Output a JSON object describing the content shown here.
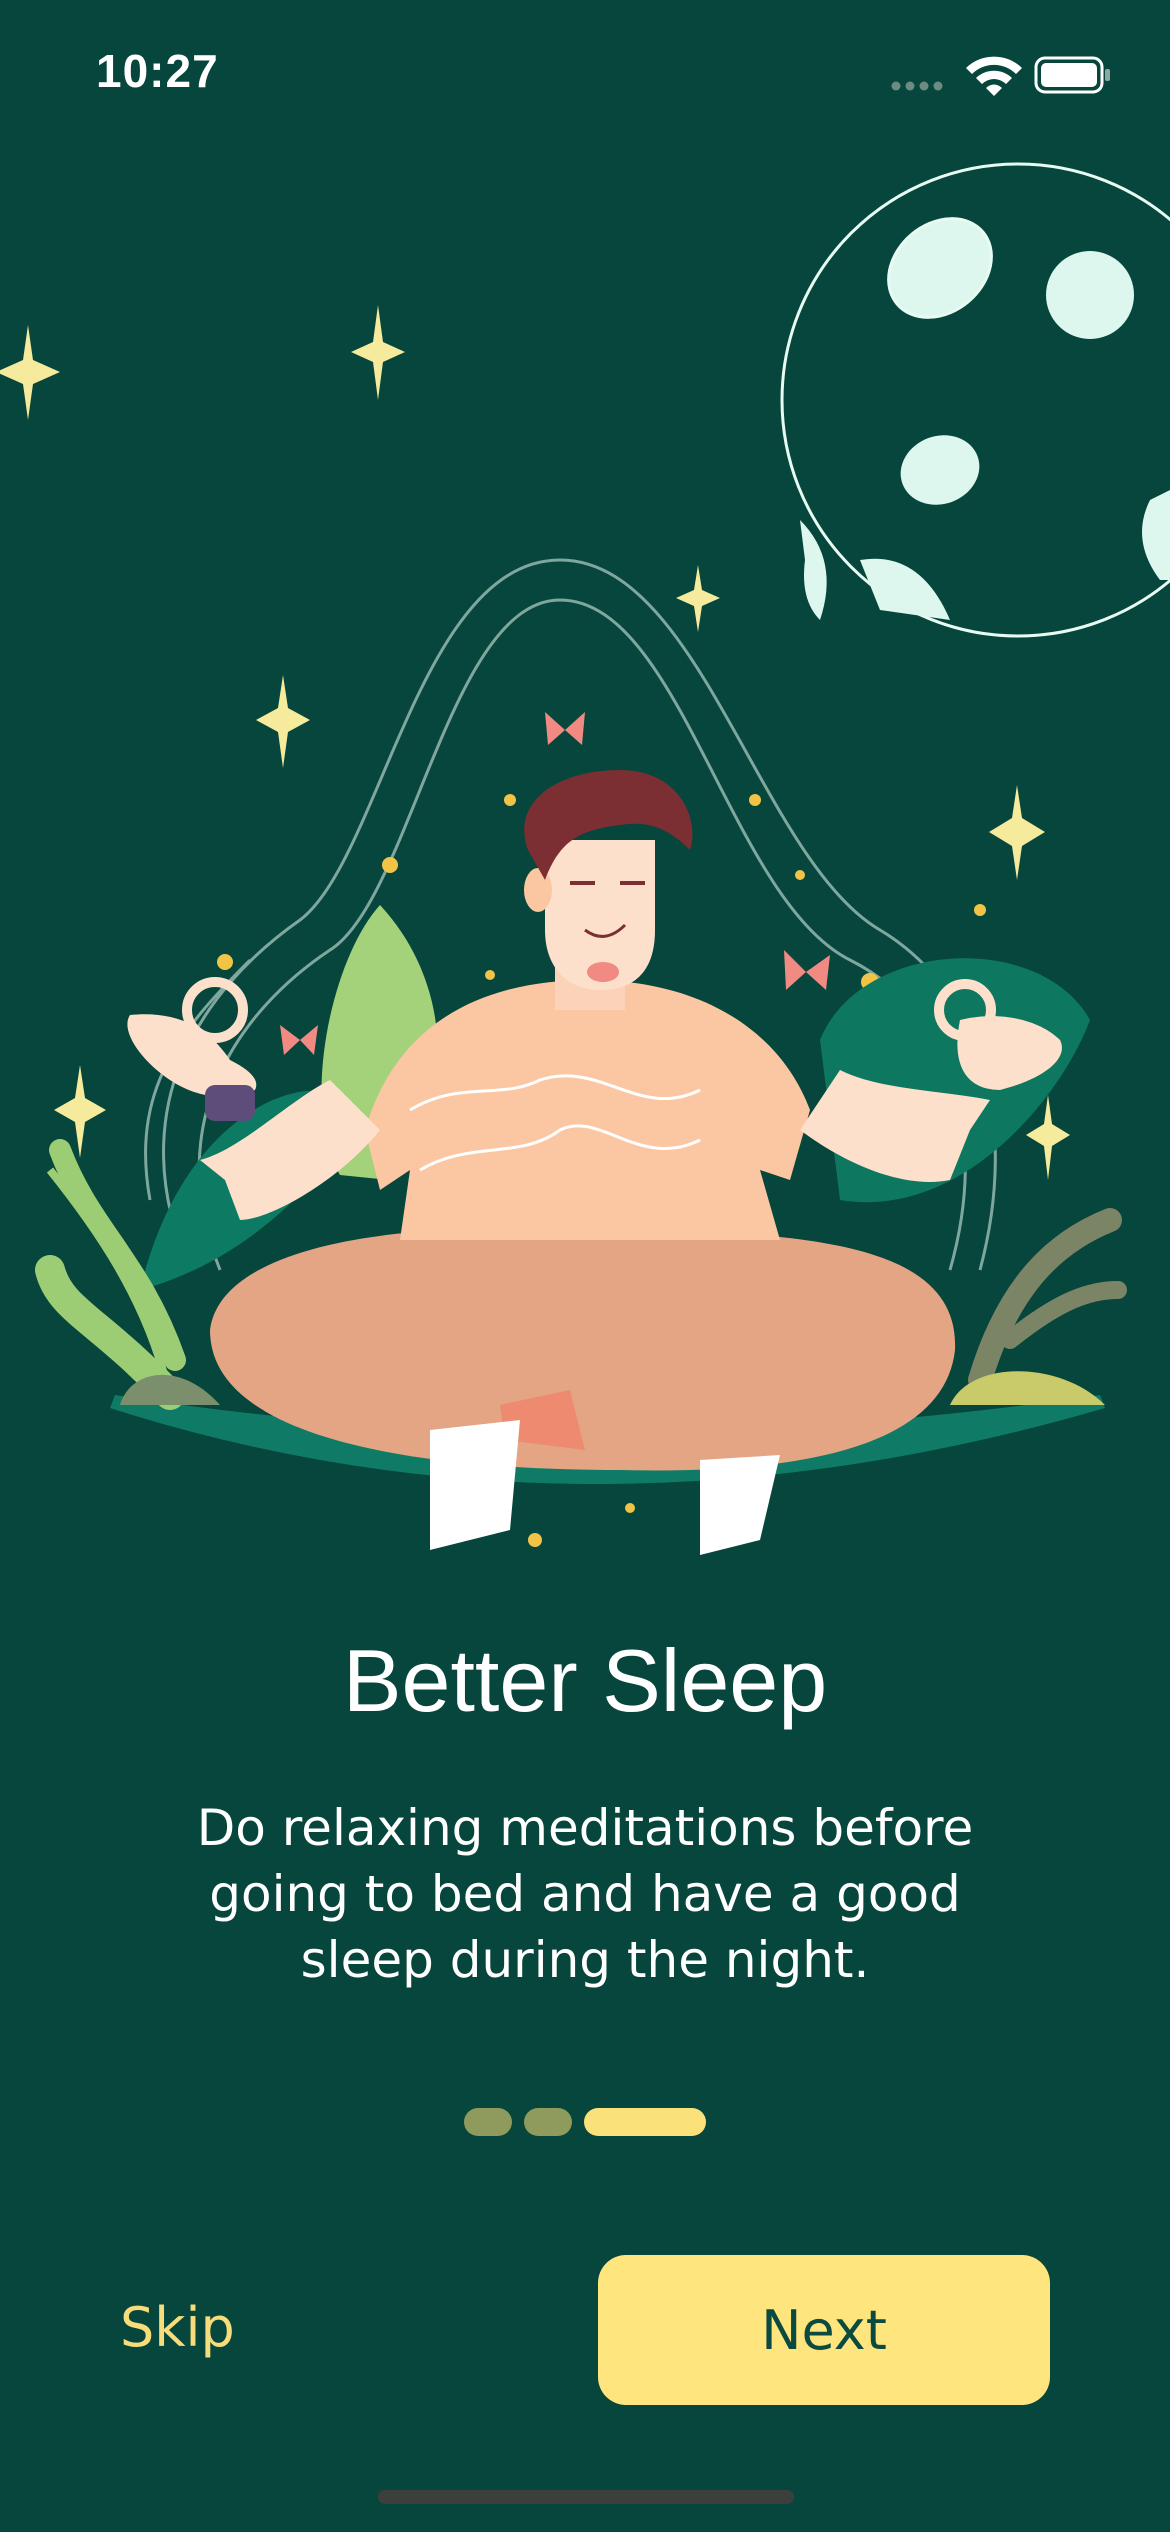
{
  "status_bar": {
    "time": "10:27",
    "icons": [
      "signal-dots-icon",
      "wifi-icon",
      "battery-icon"
    ]
  },
  "illustration": {
    "subject": "person meditating in lotus pose",
    "icons": [
      "moon-icon",
      "sparkle-star-icon",
      "leaf-icon",
      "butterfly-icon",
      "smartwatch-icon"
    ]
  },
  "onboarding": {
    "title": "Better Sleep",
    "description": "Do relaxing meditations before going to bed and have a good sleep during the night.",
    "page_count": 3,
    "active_page": 3
  },
  "actions": {
    "skip_label": "Skip",
    "next_label": "Next"
  },
  "colors": {
    "background": "#06463c",
    "accent": "#fee57e",
    "text": "#ffffff",
    "inactive_dot": "#8f9a5d"
  }
}
